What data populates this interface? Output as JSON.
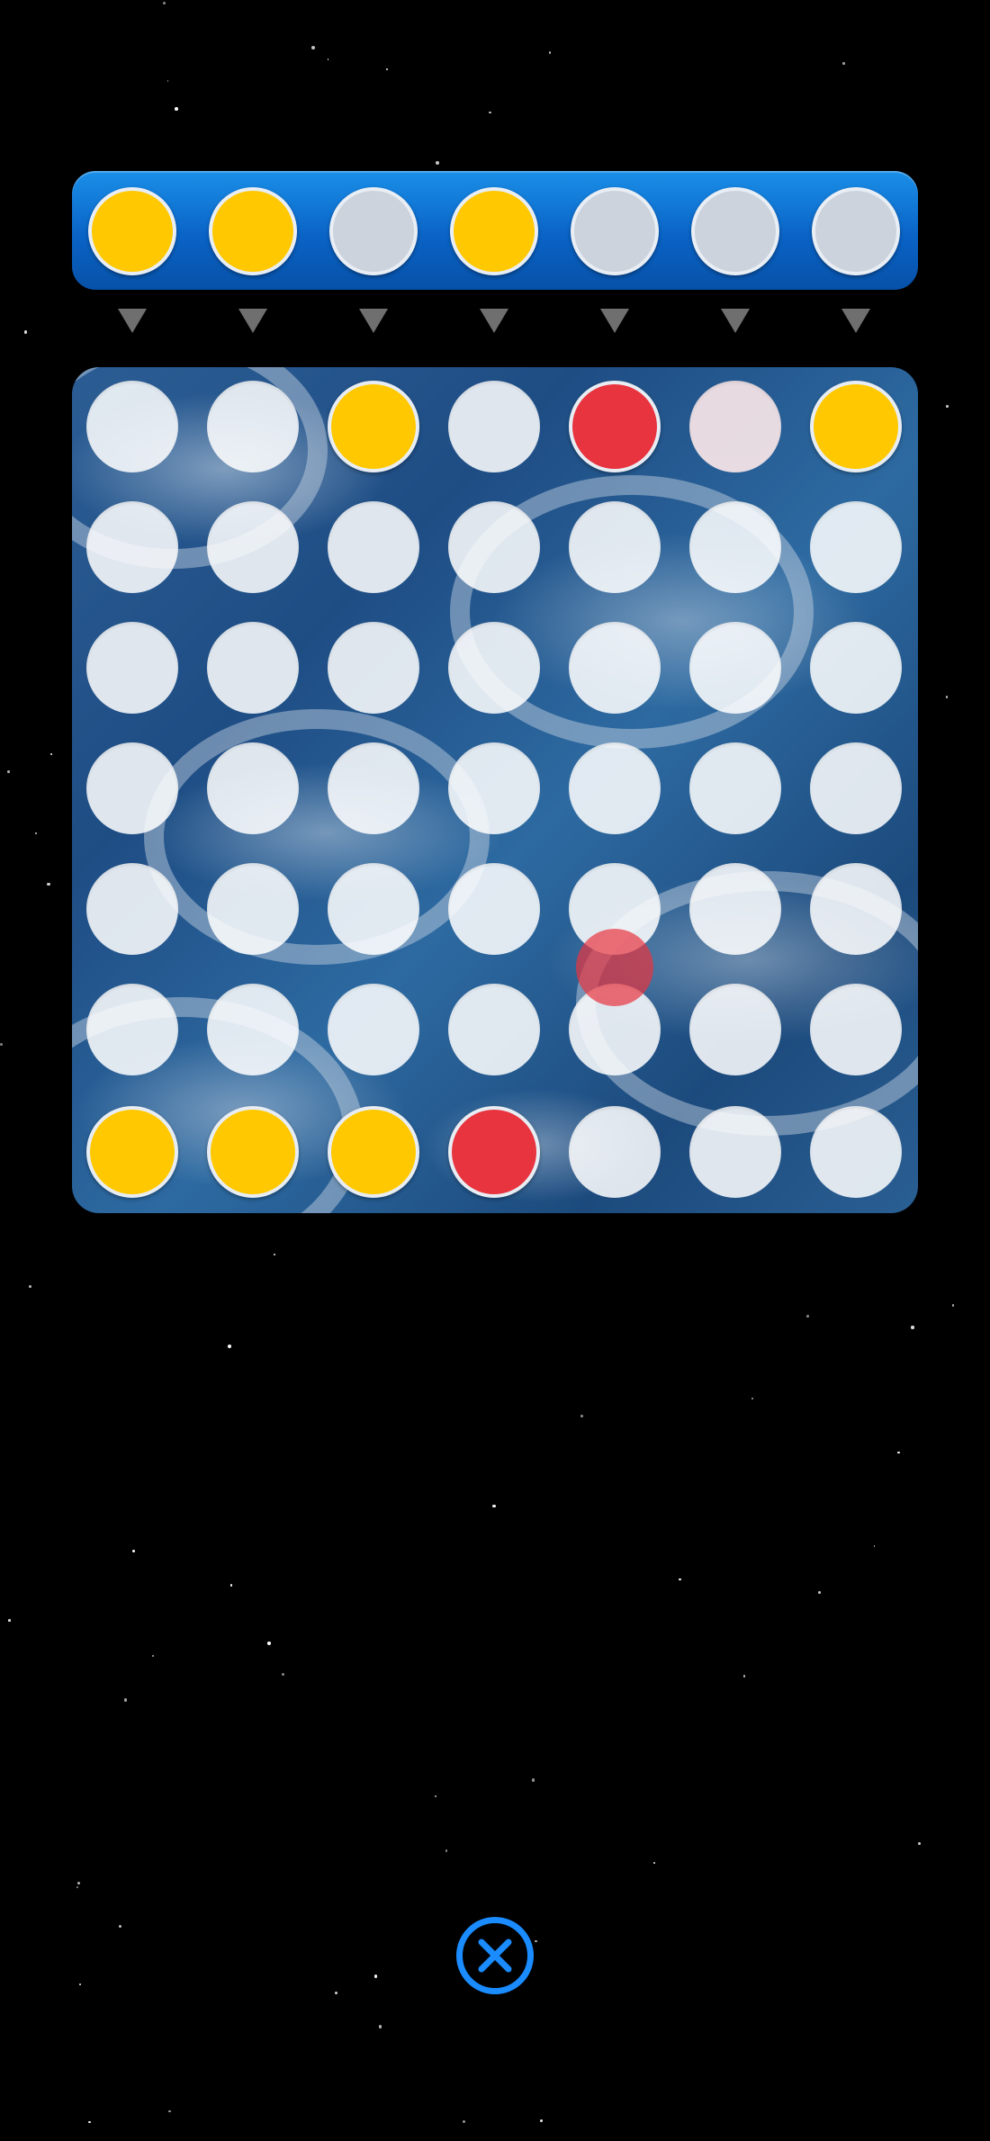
{
  "colors": {
    "yellow": "#ffc800",
    "red": "#e8343f",
    "empty_slot": "#cdd3dc",
    "hint_pink": "#fde9ea",
    "accent_blue": "#1a8cff",
    "arrow_gray": "#6f6f6f"
  },
  "selector": {
    "slots": [
      "yellow",
      "yellow",
      "empty",
      "yellow",
      "empty",
      "empty",
      "empty"
    ]
  },
  "drop_arrows": {
    "count": 7,
    "icon": "triangle-down-icon"
  },
  "board": {
    "columns": 7,
    "rows": 7,
    "cells": [
      [
        "empty",
        "empty",
        "yellow",
        "empty",
        "red",
        "hint",
        "yellow"
      ],
      [
        "empty",
        "empty",
        "empty",
        "empty",
        "empty",
        "empty",
        "empty"
      ],
      [
        "empty",
        "empty",
        "empty",
        "empty",
        "empty",
        "empty",
        "empty"
      ],
      [
        "empty",
        "empty",
        "empty",
        "empty",
        "empty",
        "empty",
        "empty"
      ],
      [
        "empty",
        "empty",
        "empty",
        "empty",
        "empty",
        "empty",
        "empty"
      ],
      [
        "empty",
        "empty",
        "empty",
        "empty",
        "empty",
        "empty",
        "empty"
      ],
      [
        "yellow",
        "yellow",
        "yellow",
        "red",
        "empty",
        "empty",
        "empty"
      ]
    ],
    "falling_piece": {
      "color": "red",
      "column": 5,
      "between_rows": [
        5,
        6
      ]
    }
  },
  "close_button": {
    "icon": "close-icon"
  }
}
